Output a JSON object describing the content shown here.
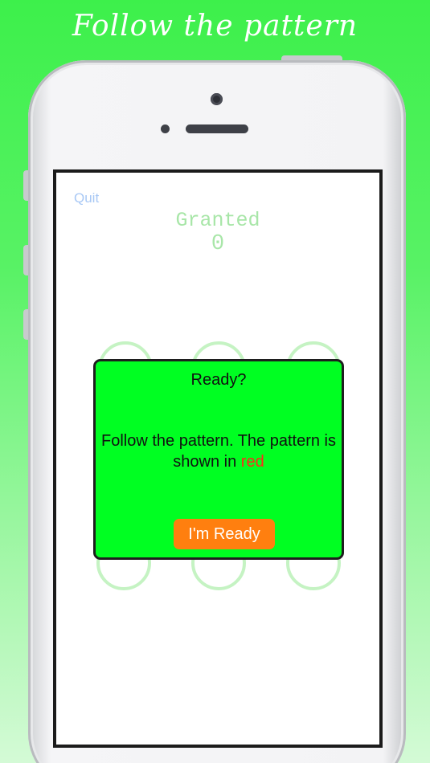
{
  "headline": "Follow the pattern",
  "screen": {
    "quit_label": "Quit",
    "status_title": "Granted",
    "score": "0"
  },
  "dialog": {
    "title": "Ready?",
    "message_prefix": "Follow the pattern. The pattern is shown in ",
    "message_highlight": "red",
    "button_label": "I'm Ready"
  },
  "colors": {
    "background_green": "#3df04b",
    "dialog_green": "#00ff22",
    "button_orange": "#ff7f0f",
    "highlight_red": "#ff2a1a",
    "circle_border": "#c5f3c3",
    "quit_blue": "#a8c8f5"
  }
}
